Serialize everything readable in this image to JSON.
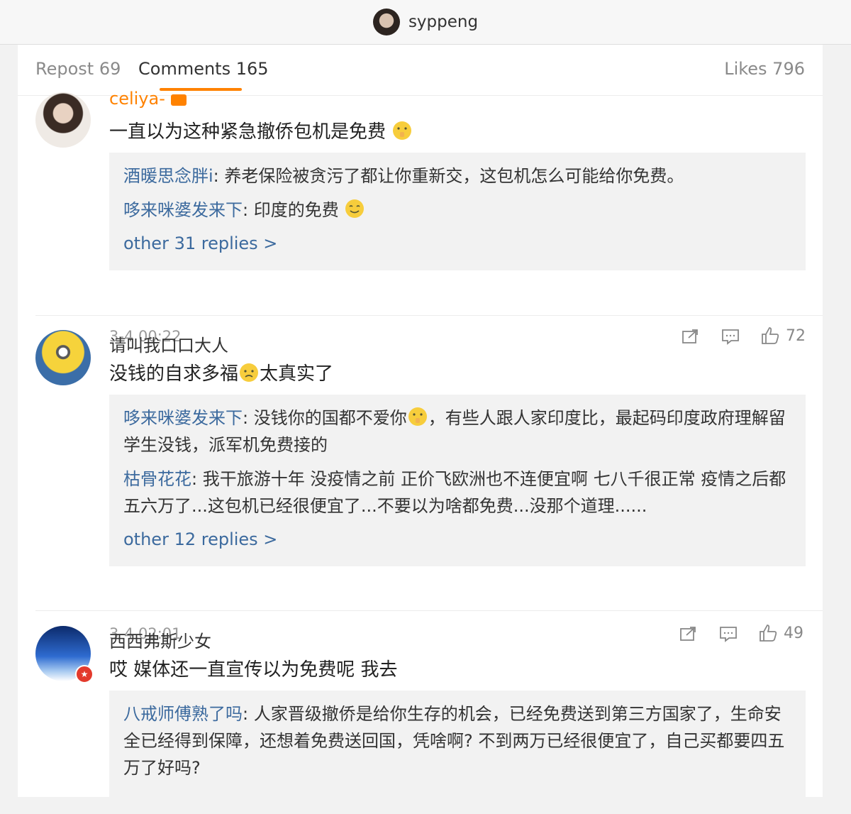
{
  "header": {
    "username": "syppeng"
  },
  "tabs": {
    "repost": "Repost 69",
    "comments": "Comments 165",
    "likes": "Likes 796"
  },
  "comments": [
    {
      "user": "celiya-",
      "text": "一直以为这种紧急撤侨包机是免费",
      "replies": [
        {
          "user": "酒暖思念胖i",
          "text": ": 养老保险被贪污了都让你重新交，这包机怎么可能给你免费。"
        },
        {
          "user": "哆来咪婆发来下",
          "text": ": 印度的免费"
        }
      ],
      "more": "other 31 replies >",
      "time": "3-4 00:22",
      "likes": "72"
    },
    {
      "user": "请叫我口口大人",
      "text_a": "没钱的自求多福",
      "text_b": "太真实了",
      "replies": [
        {
          "user": "哆来咪婆发来下",
          "text_a": ": 没钱你的国都不爱你",
          "text_b": "，有些人跟人家印度比，最起码印度政府理解留学生没钱，派军机免费接的"
        },
        {
          "user": "枯骨花花",
          "text": ": 我干旅游十年 没疫情之前 正价飞欧洲也不连便宜啊 七八千很正常 疫情之后都五六万了...这包机已经很便宜了...不要以为啥都免费...没那个道理......"
        }
      ],
      "more": "other 12 replies >",
      "time": "3-4 02:01",
      "likes": "49"
    },
    {
      "user": "西西弗斯少女",
      "text": "哎 媒体还一直宣传以为免费呢 我去",
      "replies": [
        {
          "user": "八戒师傅熟了吗",
          "text": ": 人家晋级撤侨是给你生存的机会，已经免费送到第三方国家了，生命安全已经得到保障，还想着免费送回国，凭啥啊? 不到两万已经很便宜了，自己买都要四五万了好吗?"
        }
      ]
    }
  ]
}
